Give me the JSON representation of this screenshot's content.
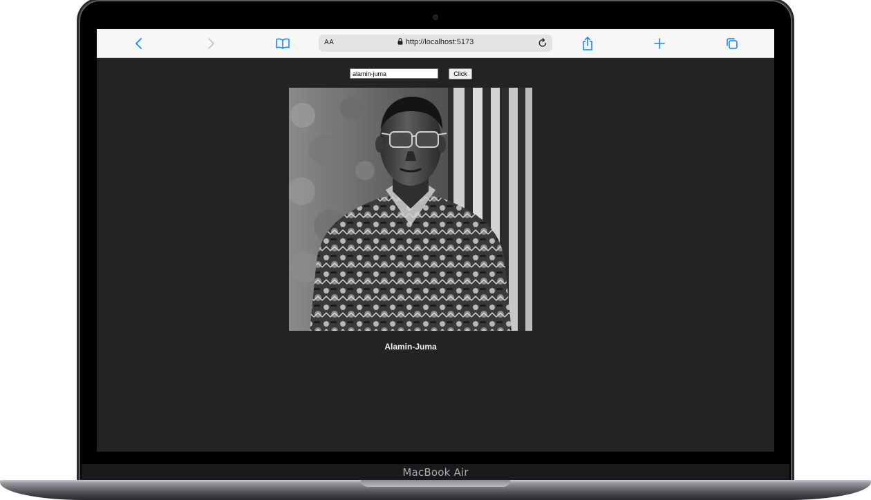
{
  "browser": {
    "text_size_label": "AA",
    "url": "http://localhost:5173",
    "icons": {
      "back": "chevron-left-icon",
      "forward": "chevron-right-icon",
      "bookmarks": "book-icon",
      "lock": "lock-icon",
      "reload": "reload-icon",
      "share": "share-icon",
      "new_tab": "plus-icon",
      "tabs": "tabs-icon"
    },
    "accent_color": "#0a84ff"
  },
  "page": {
    "background_color": "#232323",
    "search": {
      "value": "alamin-juma"
    },
    "button_label": "Click",
    "profile": {
      "name": "Alamin-Juma",
      "image_description": "black and white portrait photo"
    }
  },
  "device": {
    "label": "MacBook Air"
  }
}
